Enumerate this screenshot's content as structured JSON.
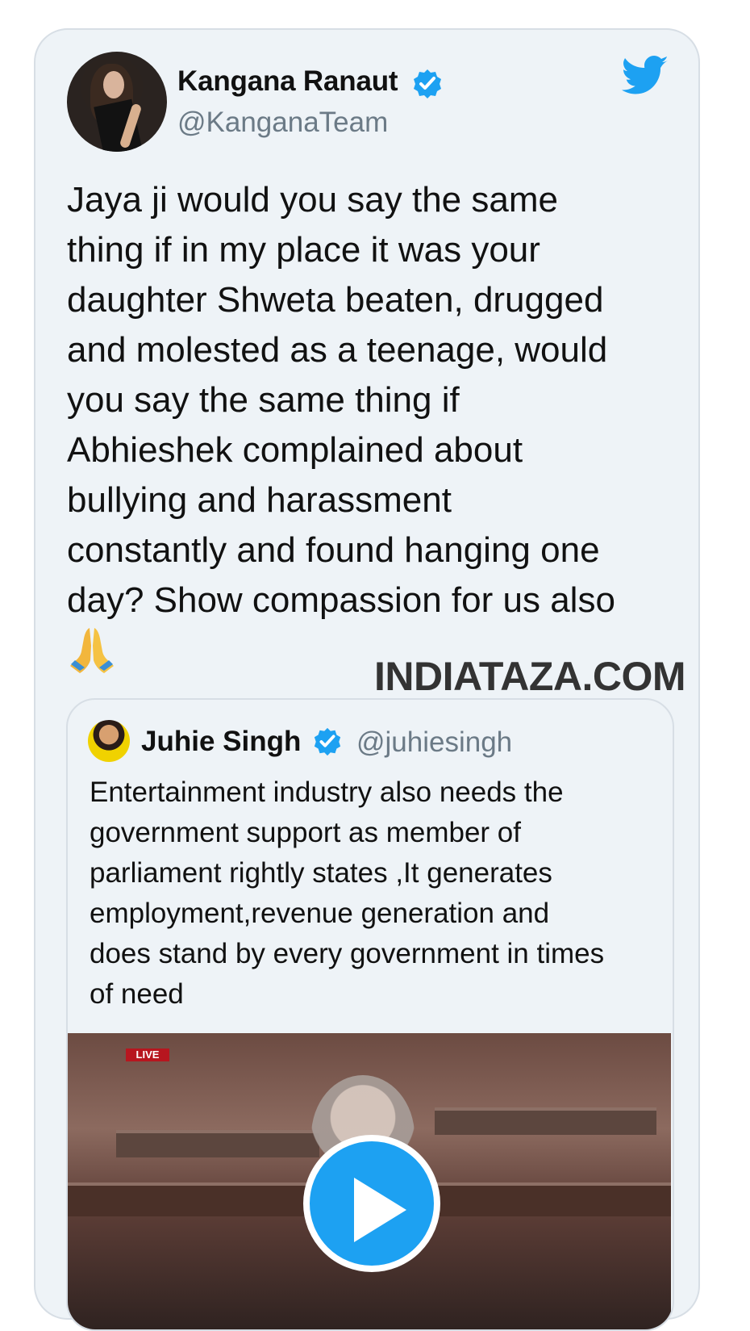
{
  "tweet": {
    "author_name": "Kangana Ranaut",
    "author_handle": "@KanganaTeam",
    "text": "Jaya ji would you say the same\nthing if in my place it was your\ndaughter Shweta beaten, drugged\nand molested as a teenage, would\nyou say the same thing if\nAbhieshek complained about\nbullying and harassment\nconstantly and found hanging one\nday? Show compassion for us also",
    "emoji": "folded-hands",
    "watermark": "INDIATAZA.COM"
  },
  "quoted_tweet": {
    "author_name": "Juhie Singh",
    "author_handle": "@juhiesingh",
    "text": "Entertainment industry also needs the\ngovernment support as member of\nparliament rightly states ,It generates\nemployment,revenue generation and\ndoes stand by every government in times\nof need",
    "media_badge": "LIVE"
  },
  "icons": {
    "verified": "verified-badge-icon",
    "twitter": "twitter-bird-icon",
    "play": "play-icon"
  },
  "colors": {
    "twitter_blue": "#1da1f2",
    "card_background": "#eef3f7",
    "muted_text": "#6b7a86"
  }
}
